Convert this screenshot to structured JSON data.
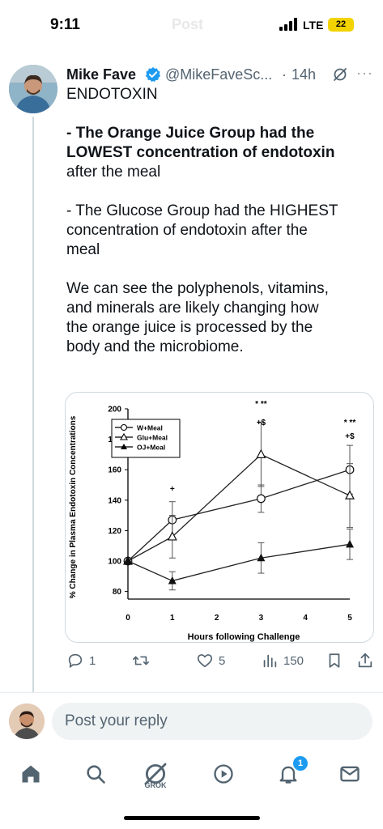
{
  "status_bar": {
    "time": "9:11",
    "ghost_title": "Post",
    "network": "LTE",
    "battery": "22"
  },
  "tweet": {
    "author_name": "Mike Fave",
    "handle": "@MikeFaveSc...",
    "separator": "·",
    "age": "14h",
    "more": "···",
    "lines": [
      {
        "id": "l1",
        "text": "ENDOTOXIN"
      },
      {
        "id": "l2",
        "text": "- The Orange Juice Group had the"
      },
      {
        "id": "l3",
        "text": "LOWEST concentration of endotoxin"
      },
      {
        "id": "l4",
        "text": "after the meal"
      },
      {
        "id": "l5",
        "text": "- The Glucose Group had the HIGHEST"
      },
      {
        "id": "l6",
        "text": "concentration of endotoxin after the"
      },
      {
        "id": "l7",
        "text": "meal"
      },
      {
        "id": "l8",
        "text": "We can see the polyphenols, vitamins,"
      },
      {
        "id": "l9",
        "text": "and minerals are likely changing how"
      },
      {
        "id": "l10",
        "text": "the orange juice is processed by the"
      },
      {
        "id": "l11",
        "text": "body and the microbiome."
      }
    ],
    "metrics": {
      "replies": "1",
      "likes": "5",
      "views": "150"
    }
  },
  "chart_data": {
    "type": "line",
    "title": "",
    "xlabel": "Hours following Challenge",
    "ylabel": "% Change in Plasma Endotoxin Concentrations",
    "x": [
      0,
      1,
      3,
      5
    ],
    "xticks": [
      "0",
      "1",
      "2",
      "3",
      "4",
      "5"
    ],
    "yticks": [
      "80",
      "100",
      "120",
      "140",
      "160",
      "180",
      "200"
    ],
    "xlim": [
      0,
      5
    ],
    "ylim": [
      75,
      200
    ],
    "grid": false,
    "legend_position": "top-left",
    "series": [
      {
        "name": "W+Meal",
        "marker": "open-circle",
        "values": [
          100,
          127,
          141,
          160
        ],
        "err": [
          0,
          12,
          9,
          16
        ]
      },
      {
        "name": "Glu+Meal",
        "marker": "open-triangle",
        "values": [
          100,
          116,
          170,
          143
        ],
        "err": [
          0,
          14,
          21,
          21
        ]
      },
      {
        "name": "OJ+Meal",
        "marker": "filled-triangle",
        "values": [
          100,
          87,
          102,
          111
        ],
        "err": [
          0,
          6,
          10,
          10
        ]
      }
    ],
    "annotations": [
      {
        "x": 1,
        "text": "+"
      },
      {
        "x": 3,
        "text": "* **"
      },
      {
        "x": 3,
        "text": "+$"
      },
      {
        "x": 5,
        "text": "* **"
      },
      {
        "x": 5,
        "text": "+$"
      }
    ]
  },
  "reply": {
    "placeholder": "Post your reply"
  },
  "nav": {
    "grok_label": "GROK",
    "notification_count": "1"
  },
  "colors": {
    "accent": "#1d9bf0",
    "text": "#0f1419",
    "muted": "#536471",
    "battery": "#f2d300"
  },
  "icons": [
    "home-icon",
    "search-icon",
    "grok-icon",
    "video-icon",
    "bell-icon",
    "mail-icon",
    "reply-icon",
    "repost-icon",
    "like-icon",
    "views-icon",
    "bookmark-icon",
    "share-icon",
    "verified-icon",
    "more-icon"
  ]
}
